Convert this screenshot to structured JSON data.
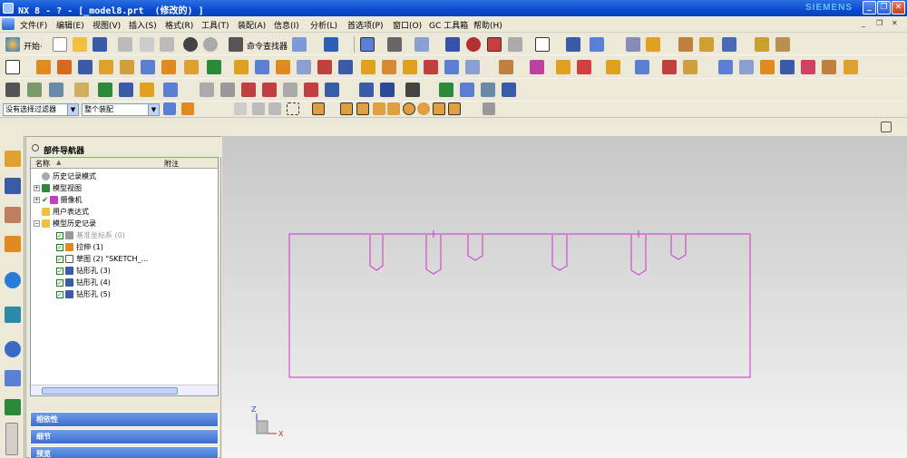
{
  "window": {
    "title": "NX 8 - ? - [_model8.prt  (修改的) ]",
    "brand": "SIEMENS",
    "controls": [
      "_",
      "❐",
      "✕"
    ]
  },
  "menu": [
    "文件(F)",
    "编辑(E)",
    "视图(V)",
    "插入(S)",
    "格式(R)",
    "工具(T)",
    "装配(A)",
    "信息(I)",
    "分析(L)",
    "首选项(P)",
    "窗口(O)",
    "GC 工具箱",
    "帮助(H)"
  ],
  "doc_controls": [
    "_",
    "❐",
    "✕"
  ],
  "toolbar": {
    "start_label": "开始·",
    "command_finder_label": "命令查找器"
  },
  "filter": {
    "selection_filter": "没有选择过滤器",
    "assembly_scope": "整个装配"
  },
  "navigator": {
    "title": "部件导航器",
    "columns": [
      "名称",
      "附注"
    ],
    "items": [
      {
        "label": "历史记录模式"
      },
      {
        "label": "模型视图"
      },
      {
        "label": "摄像机"
      },
      {
        "label": "用户表达式"
      },
      {
        "label": "模型历史记录"
      },
      {
        "label": "基准坐标系 (0)"
      },
      {
        "label": "拉伸 (1)"
      },
      {
        "label": "草图 (2) \"SKETCH_..."
      },
      {
        "label": "钻形孔 (3)"
      },
      {
        "label": "钻形孔 (4)"
      },
      {
        "label": "钻形孔 (5)"
      }
    ],
    "sections": [
      "相依性",
      "细节",
      "预览"
    ]
  },
  "viewport": {
    "triad": {
      "z": "Z",
      "x": "X"
    }
  },
  "colors": {
    "sketch": "#cc33cc",
    "titlebar": "#0a4ad0",
    "section_bar": "#3b6fcf"
  }
}
